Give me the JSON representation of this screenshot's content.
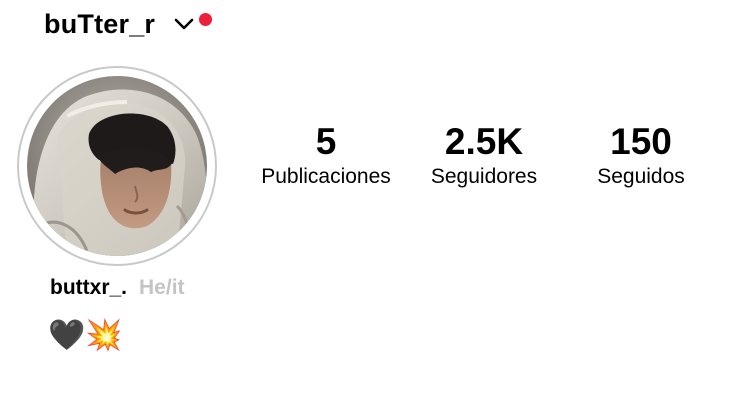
{
  "header": {
    "username": "buTter_r",
    "chevron_icon": "chevron-down-icon",
    "notification_color": "#ed1f3b"
  },
  "profile": {
    "avatar_icon": "profile-photo",
    "display_name": "buttxr_.",
    "pronouns": "He/it",
    "bio": "🖤💥"
  },
  "stats": {
    "posts": {
      "value": "5",
      "label": "Publicaciones"
    },
    "followers": {
      "value": "2.5K",
      "label": "Seguidores"
    },
    "following": {
      "value": "150",
      "label": "Seguidos"
    }
  }
}
